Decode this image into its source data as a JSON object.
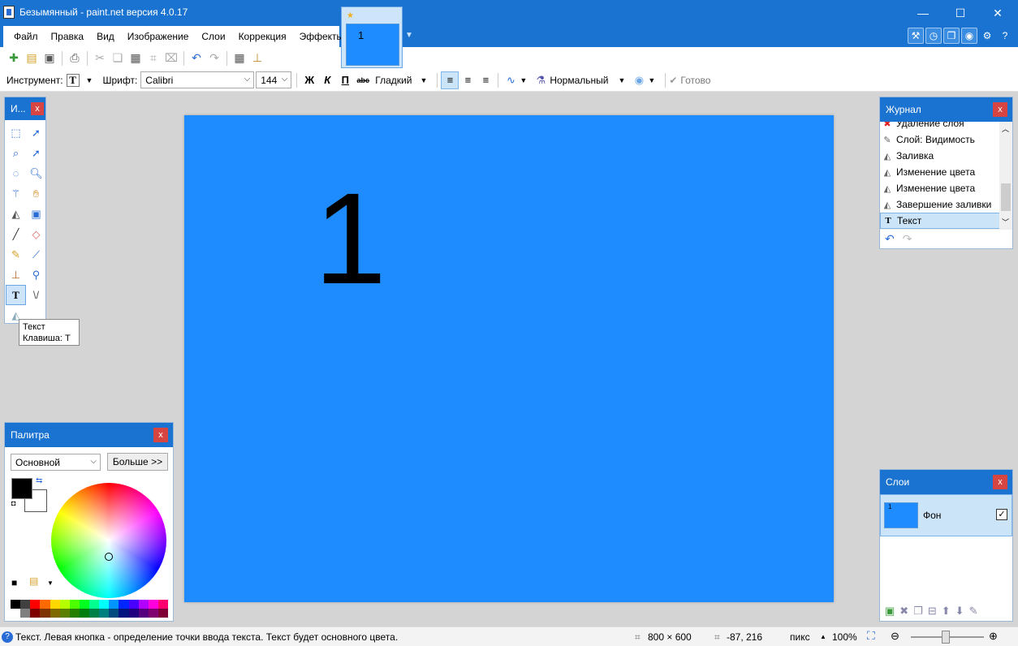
{
  "window": {
    "title": "Безымянный - paint.net версия 4.0.17",
    "minimize": "—",
    "maximize": "☐",
    "close": "✕"
  },
  "menu": {
    "items": [
      "Файл",
      "Правка",
      "Вид",
      "Изображение",
      "Слои",
      "Коррекция",
      "Эффекты"
    ]
  },
  "doc_tab": {
    "thumb_text": "1"
  },
  "toolbar": {
    "tool_label": "Инструмент:",
    "font_label": "Шрифт:",
    "font_value": "Calibri",
    "size_value": "144",
    "bold": "Ж",
    "italic": "К",
    "underline": "П",
    "strike": "abc",
    "antialias": "Гладкий",
    "blend": "Нормальный",
    "finish": "Готово"
  },
  "canvas": {
    "text": "1",
    "color": "#1e8bff"
  },
  "tools_panel": {
    "title": "И..."
  },
  "tooltip": {
    "line1": "Текст",
    "line2": "Клавиша: T"
  },
  "history": {
    "title": "Журнал",
    "items": [
      {
        "label": "Удаление слоя",
        "icon": "delete-icon"
      },
      {
        "label": "Слой: Видимость",
        "icon": "layer-properties-icon"
      },
      {
        "label": "Заливка",
        "icon": "paint-bucket-icon"
      },
      {
        "label": "Изменение цвета",
        "icon": "paint-bucket-icon"
      },
      {
        "label": "Изменение цвета",
        "icon": "paint-bucket-icon"
      },
      {
        "label": "Завершение заливки",
        "icon": "paint-bucket-icon"
      },
      {
        "label": "Текст",
        "icon": "text-icon"
      }
    ]
  },
  "palette": {
    "title": "Палитра",
    "mode": "Основной",
    "more": "Больше >>",
    "colors_row1": [
      "#000000",
      "#404040",
      "#ff0000",
      "#ff6a00",
      "#ffd800",
      "#b6ff00",
      "#4cff00",
      "#00ff21",
      "#00ff90",
      "#00ffff",
      "#0094ff",
      "#0026ff",
      "#4800ff",
      "#b200ff",
      "#ff00dc",
      "#ff006e"
    ],
    "colors_row2": [
      "#ffffff",
      "#808080",
      "#7f0000",
      "#7f3300",
      "#7f6a00",
      "#5b7f00",
      "#267f00",
      "#007f0e",
      "#007f46",
      "#007f7f",
      "#004a7f",
      "#00137f",
      "#21007f",
      "#57007f",
      "#7f006e",
      "#7f0037"
    ]
  },
  "layers": {
    "title": "Слои",
    "items": [
      {
        "name": "Фон",
        "thumb_text": "1",
        "visible": "✓"
      }
    ]
  },
  "status": {
    "message": "Текст. Левая кнопка - определение точки ввода текста. Текст будет основного цвета.",
    "image_size": "800 × 600",
    "cursor": "-87, 216",
    "units": "пикс",
    "zoom": "100%"
  }
}
